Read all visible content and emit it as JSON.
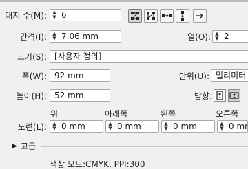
{
  "pages": {
    "label": "대지 수(M):",
    "value": "6"
  },
  "layout_buttons": [
    {
      "name": "grid-by-row-icon"
    },
    {
      "name": "grid-by-column-icon"
    },
    {
      "name": "arrange-by-row-icon"
    },
    {
      "name": "arrange-by-column-icon"
    },
    {
      "name": "right-to-left-icon"
    }
  ],
  "spacing": {
    "label": "간격(I):",
    "value": "7.06 mm"
  },
  "columns": {
    "label": "열(O):",
    "value": "2"
  },
  "size": {
    "label": "크기(S):",
    "value": "[사용자 정의]"
  },
  "width": {
    "label": "폭(W):",
    "value": "92 mm"
  },
  "units": {
    "label": "단위(U):",
    "value": "밀리미터"
  },
  "height": {
    "label": "높이(H):",
    "value": "52 mm"
  },
  "orientation": {
    "label": "방향:",
    "portrait_icon": "portrait-icon",
    "landscape_icon": "landscape-icon"
  },
  "bleed": {
    "label": "도련(L):",
    "top": {
      "label": "위",
      "value": "0 mm"
    },
    "bottom": {
      "label": "아래쪽",
      "value": "0 mm"
    },
    "left": {
      "label": "왼쪽",
      "value": "0 mm"
    },
    "right": {
      "label": "오른쪽",
      "value": "0 mm"
    }
  },
  "advanced": {
    "label": "고급"
  },
  "color_mode_text": "색상 모드:CMYK, PPI:300"
}
